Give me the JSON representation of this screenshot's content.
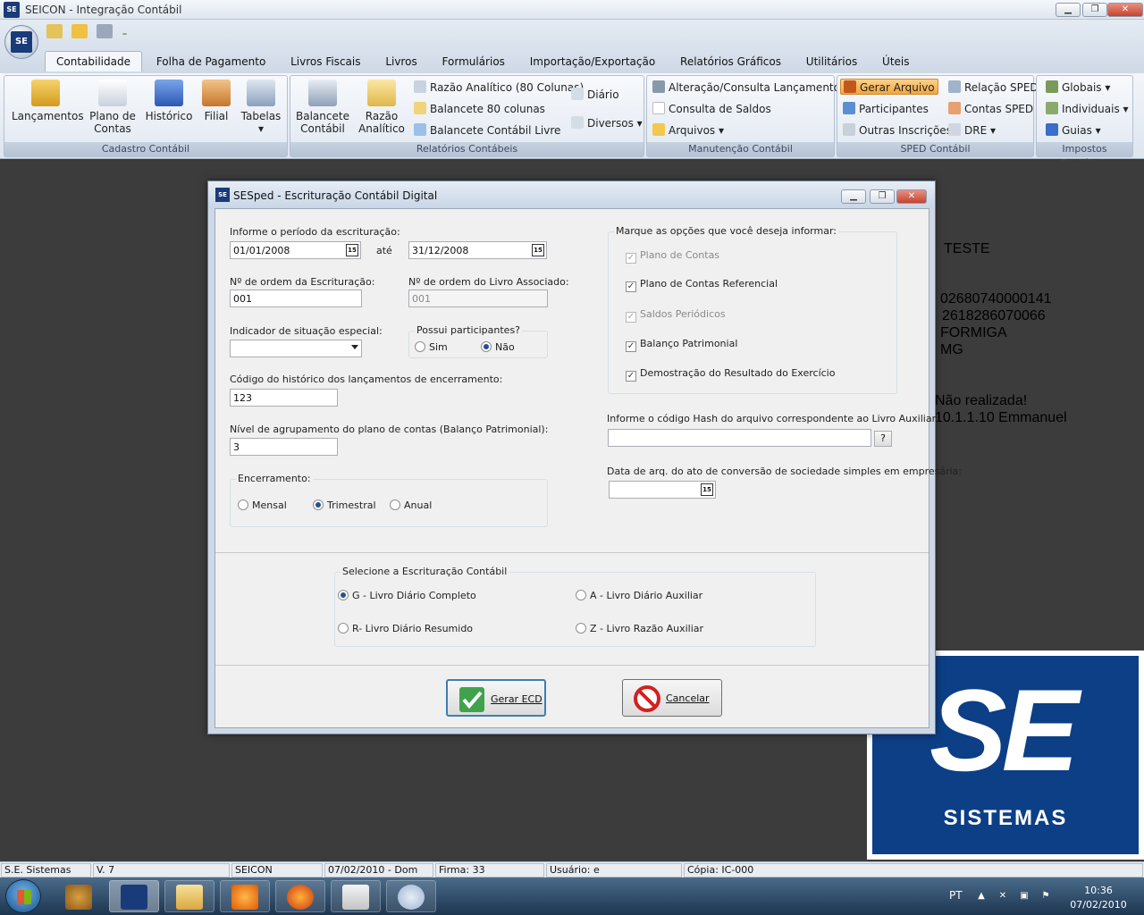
{
  "window": {
    "title": "SEICON - Integração Contábil",
    "icon_text": "SE",
    "minimize": "▁",
    "maximize": "❐",
    "close": "✕"
  },
  "orb_text": "SE",
  "tabs": [
    "Contabilidade",
    "Folha de Pagamento",
    "Livros Fiscais",
    "Livros",
    "Formulários",
    "Importação/Exportação",
    "Relatórios Gráficos",
    "Utilitários",
    "Úteis"
  ],
  "ribbon": {
    "cadastro": {
      "label": "Cadastro Contábil",
      "lancamentos": "Lançamentos",
      "plano_line1": "Plano de",
      "plano_line2": "Contas",
      "historico": "Histórico",
      "filial": "Filial",
      "tabelas": "Tabelas"
    },
    "relatorios": {
      "label": "Relatórios Contábeis",
      "balancete_line1": "Balancete",
      "balancete_line2": "Contábil",
      "razao_line1": "Razão",
      "razao_line2": "Analítico",
      "razao80": "Razão Analítico (80 Colunas)",
      "balancete80": "Balancete 80 colunas",
      "balancete_livre": "Balancete Contábil Livre",
      "diario": "Diário",
      "diversos": "Diversos"
    },
    "manutencao": {
      "label": "Manutenção Contábil",
      "alteracao": "Alteração/Consulta Lançamentos",
      "consulta": "Consulta de Saldos",
      "arquivos": "Arquivos"
    },
    "sped": {
      "label": "SPED Contábil",
      "gerar": "Gerar Arquivo",
      "participantes": "Participantes",
      "outras": "Outras Inscrições",
      "relacao": "Relação SPED",
      "contas": "Contas SPED",
      "dre": "DRE"
    },
    "impostos": {
      "label": "Impostos Contábeis",
      "globais": "Globais",
      "individuais": "Individuais",
      "guias": "Guias"
    }
  },
  "background_info": {
    "line1": "TESTE",
    "line2": "02680740000141",
    "line3": "2618286070066",
    "line4": "FORMIGA",
    "line5": "MG",
    "line6": "Não realizada!",
    "line7": "10.1.1.10  Emmanuel"
  },
  "logo": {
    "se": "SE",
    "text": "SISTEMAS"
  },
  "dialog": {
    "title": "SESped - Escrituração Contábil Digital",
    "icon_text": "SE",
    "periodo_label": "Informe o período da escrituração:",
    "data_inicio": "01/01/2008",
    "ate": "até",
    "data_fim": "31/12/2008",
    "cal_icon": "15",
    "ordem_escrituracao_label": "Nº de ordem da Escrituração:",
    "ordem_escrituracao": "001",
    "ordem_livro_label": "Nº de ordem do Livro Associado:",
    "ordem_livro": "001",
    "situacao_label": "Indicador de situação especial:",
    "participantes_legend": "Possui participantes?",
    "sim": "Sim",
    "nao": "Não",
    "historico_label": "Código do histórico dos lançamentos de encerramento:",
    "historico": "123",
    "nivel_label": "Nível de agrupamento do plano de contas (Balanço Patrimonial):",
    "nivel": "3",
    "encerramento_legend": "Encerramento:",
    "mensal": "Mensal",
    "trimestral": "Trimestral",
    "anual": "Anual",
    "opcoes_legend": "Marque as opções que você deseja informar:",
    "opt_plano": "Plano de Contas",
    "opt_plano_ref": "Plano de Contas Referencial",
    "opt_saldos": "Saldos Periódicos",
    "opt_balanco": "Balanço Patrimonial",
    "opt_dre": "Demostração do Resultado do Exercício",
    "hash_label": "Informe o código Hash do arquivo correspondente ao Livro Auxiliar:",
    "hash_button": "?",
    "conversao_label": "Data de arq. do ato de conversão de sociedade simples em empresária:",
    "escrituracao_legend": "Selecione a Escrituração Contábil",
    "esc_g": "G - Livro Diário Completo",
    "esc_a": "A - Livro Diário Auxiliar",
    "esc_r": "R- Livro Diário Resumido",
    "esc_z": "Z - Livro Razão Auxiliar",
    "gerar": "Gerar ECD",
    "cancelar": "Cancelar"
  },
  "statusbar": {
    "empresa": "S.E. Sistemas",
    "versao": "V. 7",
    "sistema": "SEICON",
    "data": "07/02/2010 - Dom",
    "firma": "Firma: 33",
    "usuario": "Usuário: e",
    "copia": "Cópia: IC-000"
  },
  "taskbar": {
    "lang": "PT",
    "time": "10:36",
    "date": "07/02/2010"
  },
  "colors": {
    "dialog_bg": "#f0f0f0",
    "logo_blue": "#0c3f86",
    "sped_highlight": "#f4a53a"
  }
}
